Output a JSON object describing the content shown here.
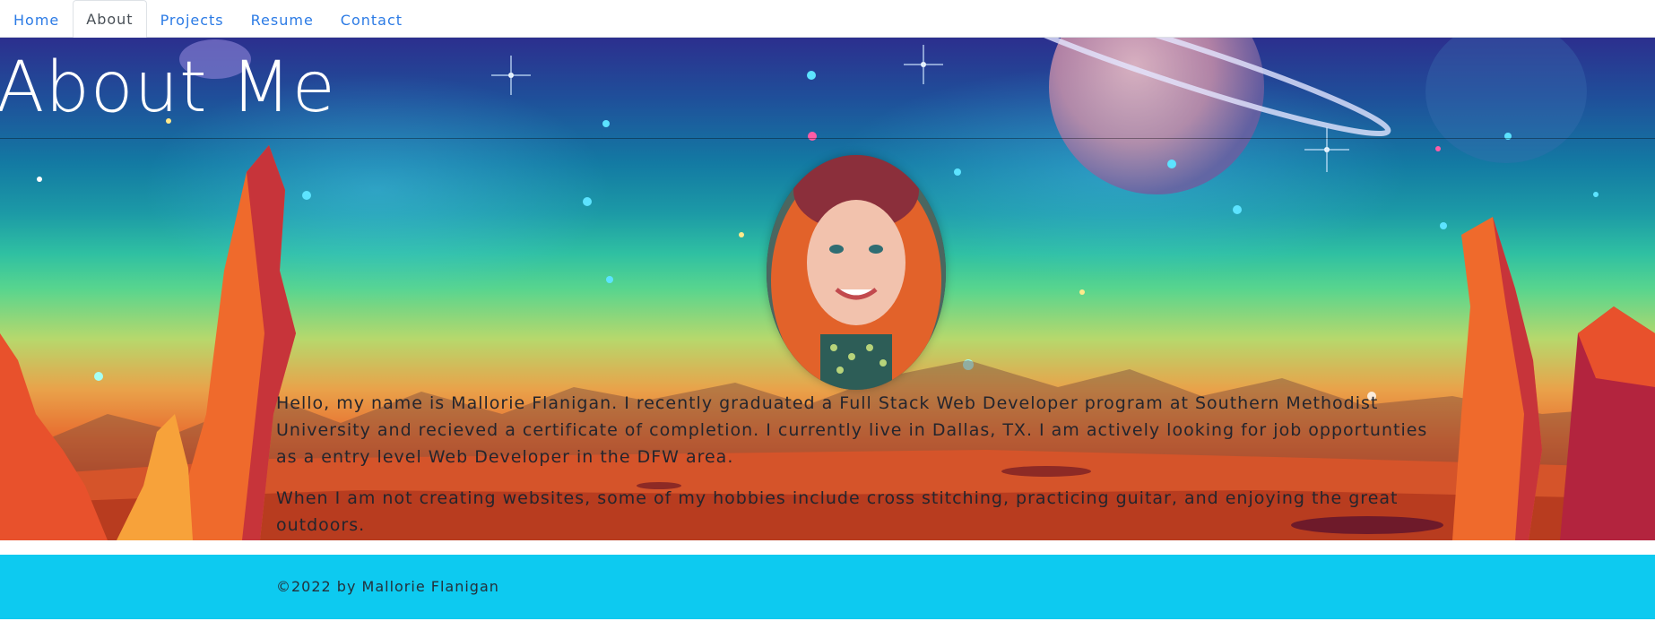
{
  "nav": {
    "items": [
      {
        "label": "Home"
      },
      {
        "label": "About"
      },
      {
        "label": "Projects"
      },
      {
        "label": "Resume"
      },
      {
        "label": "Contact"
      }
    ],
    "active": "About"
  },
  "hero": {
    "title": "About Me",
    "paragraphs": [
      "Hello, my name is Mallorie Flanigan. I recently graduated a Full Stack Web Developer program at Southern Methodist University and recieved a certificate of completion. I currently live in Dallas, TX. I am actively looking for job opportunties as a entry level Web Developer in the DFW area.",
      "When I am not creating websites, some of my hobbies include cross stitching, practicing guitar, and enjoying the great outdoors."
    ]
  },
  "footer": {
    "text": "©2022 by Mallorie Flanigan"
  },
  "colors": {
    "link": "#2c7be5",
    "footer_bg": "#0dcaf0",
    "text": "#24252d"
  }
}
